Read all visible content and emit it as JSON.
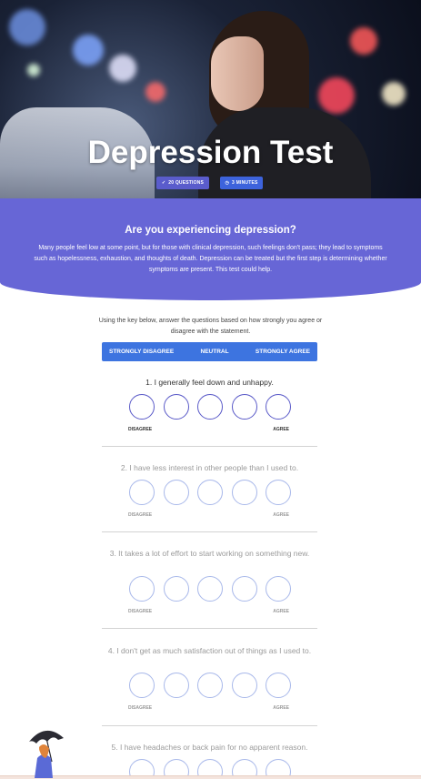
{
  "hero": {
    "title": "Depression Test",
    "badges": [
      {
        "icon": "check-icon",
        "label": "20 QUESTIONS"
      },
      {
        "icon": "clock-icon",
        "label": "3 MINUTES"
      }
    ]
  },
  "banner": {
    "title": "Are you experiencing depression?",
    "text": "Many people feel low at some point, but for those with clinical depression, such feelings don't pass; they lead to symptoms such as hopelessness, exhaustion, and thoughts of death. Depression can be treated but the first step is determining whether symptoms are present. This test could help."
  },
  "instructions": "Using the key below, answer the questions based on how strongly you agree or disagree with the statement.",
  "key": {
    "left": "STRONGLY DISAGREE",
    "middle": "NEUTRAL",
    "right": "STRONGLY AGREE"
  },
  "scale": {
    "left": "DISAGREE",
    "right": "AGREE"
  },
  "questions": [
    {
      "text": "1. I generally feel down and unhappy."
    },
    {
      "text": "2. I have less interest in other people than I used to."
    },
    {
      "text": "3. It takes a lot of effort to start working on something new."
    },
    {
      "text": "4. I don't get as much satisfaction out of things as I used to."
    },
    {
      "text": "5. I have headaches or back pain for no apparent reason."
    }
  ],
  "colors": {
    "accent": "#6766d6",
    "key_bar": "#3d74e0",
    "active_circle": "#5959c8",
    "muted_circle": "#a8b8ea"
  }
}
